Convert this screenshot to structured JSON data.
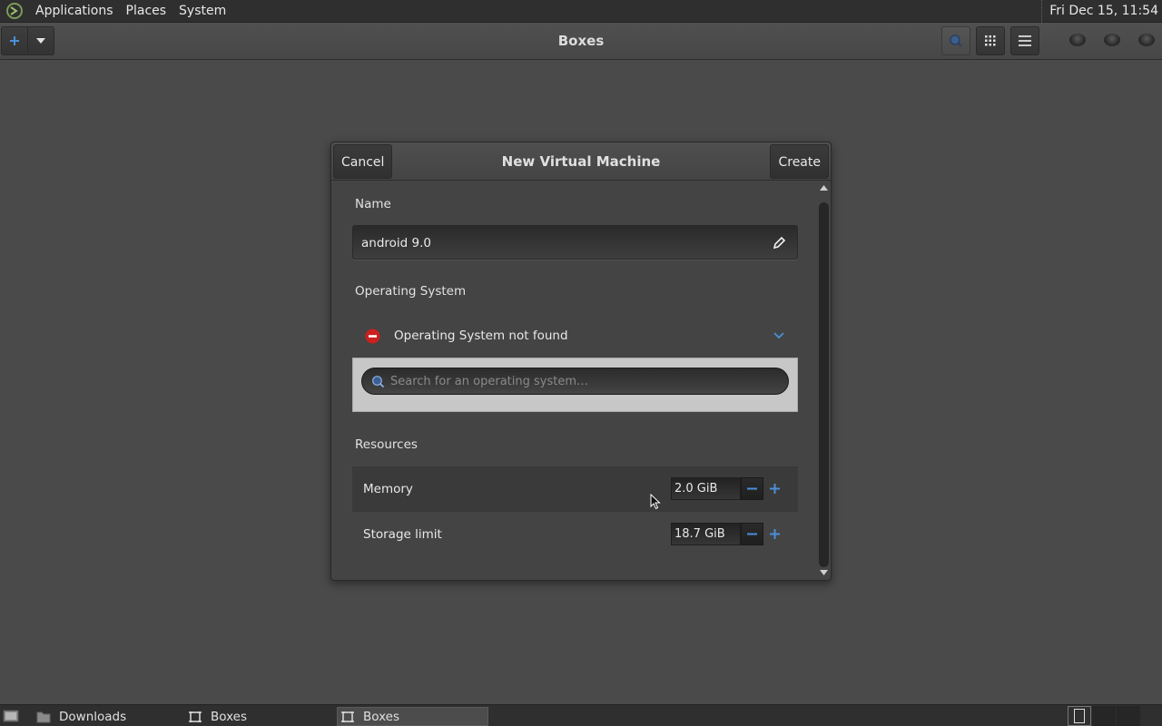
{
  "top_panel": {
    "menus": [
      "Applications",
      "Places",
      "System"
    ],
    "clock": "Fri Dec 15, 11:54"
  },
  "headerbar": {
    "title": "Boxes",
    "new_icon": "plus-icon",
    "dropdown_icon": "chevron-down-icon",
    "search_icon": "search-icon",
    "grid_icon": "grid-view-icon",
    "menu_icon": "hamburger-menu-icon"
  },
  "dialog": {
    "title": "New Virtual Machine",
    "cancel_label": "Cancel",
    "create_label": "Create",
    "name_label": "Name",
    "name_value": "android 9.0",
    "os_label": "Operating System",
    "os_status": "Operating System not found",
    "os_search_placeholder": "Search for an operating system…",
    "resources_label": "Resources",
    "resources": [
      {
        "label": "Memory",
        "value": "2.0 GiB"
      },
      {
        "label": "Storage limit",
        "value": "18.7 GiB"
      }
    ]
  },
  "taskbar": {
    "tasks": [
      {
        "label": "Downloads",
        "icon": "folder-icon"
      },
      {
        "label": "Boxes",
        "icon": "boxes-icon"
      },
      {
        "label": "Boxes",
        "icon": "boxes-icon",
        "active": true
      }
    ]
  },
  "colors": {
    "accent_blue": "#4a90d9",
    "error_red": "#cc1f1f"
  }
}
